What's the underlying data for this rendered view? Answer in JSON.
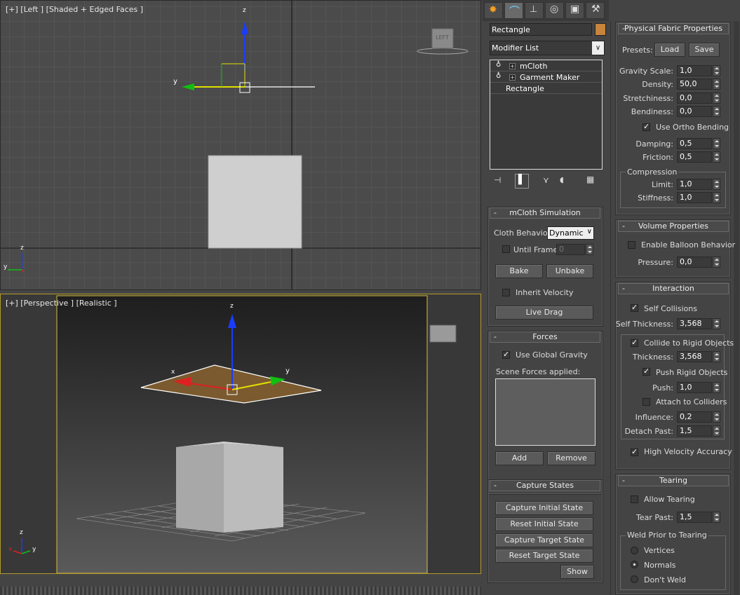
{
  "viewport_top": {
    "label": "[+] [Left ] [Shaded + Edged Faces ]",
    "axis_z": "z",
    "axis_y": "y",
    "viewcube": "LEFT"
  },
  "viewport_bottom": {
    "label": "[+] [Perspective ] [Realistic ]",
    "axis_z": "z",
    "axis_y": "y",
    "axis_x": "x",
    "gizmo_y": "y",
    "gizmo_x": "x"
  },
  "command_panel": {
    "tabs": [
      "create-icon",
      "modify-icon",
      "hierarchy-icon",
      "motion-icon",
      "display-icon",
      "utilities-icon"
    ],
    "object_name": "Rectangle",
    "object_color": "#c8843c",
    "modifier_list": "Modifier List",
    "stack": [
      "mCloth",
      "Garment Maker",
      "Rectangle"
    ]
  },
  "mcloth_simulation": {
    "title": "mCloth Simulation",
    "cloth_behavior_label": "Cloth Behavior:",
    "cloth_behavior_value": "Dynamic",
    "until_frame_label": "Until Frame",
    "until_frame_value": "0",
    "bake": "Bake",
    "unbake": "Unbake",
    "inherit_velocity": "Inherit Velocity",
    "live_drag": "Live Drag"
  },
  "forces": {
    "title": "Forces",
    "use_global_gravity": "Use Global Gravity",
    "scene_forces_label": "Scene Forces applied:",
    "add": "Add",
    "remove": "Remove"
  },
  "capture_states": {
    "title": "Capture States",
    "buttons": [
      "Capture Initial State",
      "Reset Initial State",
      "Capture Target State",
      "Reset Target State"
    ],
    "show": "Show"
  },
  "physical_fabric": {
    "title": "Physical Fabric Properties",
    "presets_label": "Presets:",
    "load": "Load",
    "save": "Save",
    "gravity_scale_label": "Gravity Scale:",
    "gravity_scale": "1,0",
    "density_label": "Density:",
    "density": "50,0",
    "stretchiness_label": "Stretchiness:",
    "stretchiness": "0,0",
    "bendiness_label": "Bendiness:",
    "bendiness": "0,0",
    "use_ortho_bending": "Use Ortho Bending",
    "damping_label": "Damping:",
    "damping": "0,5",
    "friction_label": "Friction:",
    "friction": "0,5",
    "compression_label": "Compression",
    "limit_label": "Limit:",
    "limit": "1,0",
    "stiffness_label": "Stiffness:",
    "stiffness": "1,0"
  },
  "volume_properties": {
    "title": "Volume Properties",
    "enable_balloon": "Enable Balloon Behavior",
    "pressure_label": "Pressure:",
    "pressure": "0,0"
  },
  "interaction": {
    "title": "Interaction",
    "self_collisions": "Self Collisions",
    "self_thickness_label": "Self Thickness:",
    "self_thickness": "3,568",
    "collide_rigid": "Collide to Rigid Objects",
    "thickness_label": "Thickness:",
    "thickness": "3,568",
    "push_rigid": "Push Rigid Objects",
    "push_label": "Push:",
    "push": "1,0",
    "attach_colliders": "Attach to Colliders",
    "influence_label": "Influence:",
    "influence": "0,2",
    "detach_past_label": "Detach Past:",
    "detach_past": "1,5",
    "high_velocity": "High Velocity Accuracy"
  },
  "tearing": {
    "title": "Tearing",
    "allow_tearing": "Allow Tearing",
    "tear_past_label": "Tear Past:",
    "tear_past": "1,5",
    "weld_label": "Weld Prior to Tearing",
    "vertices": "Vertices",
    "normals": "Normals",
    "dont_weld": "Don't Weld"
  }
}
